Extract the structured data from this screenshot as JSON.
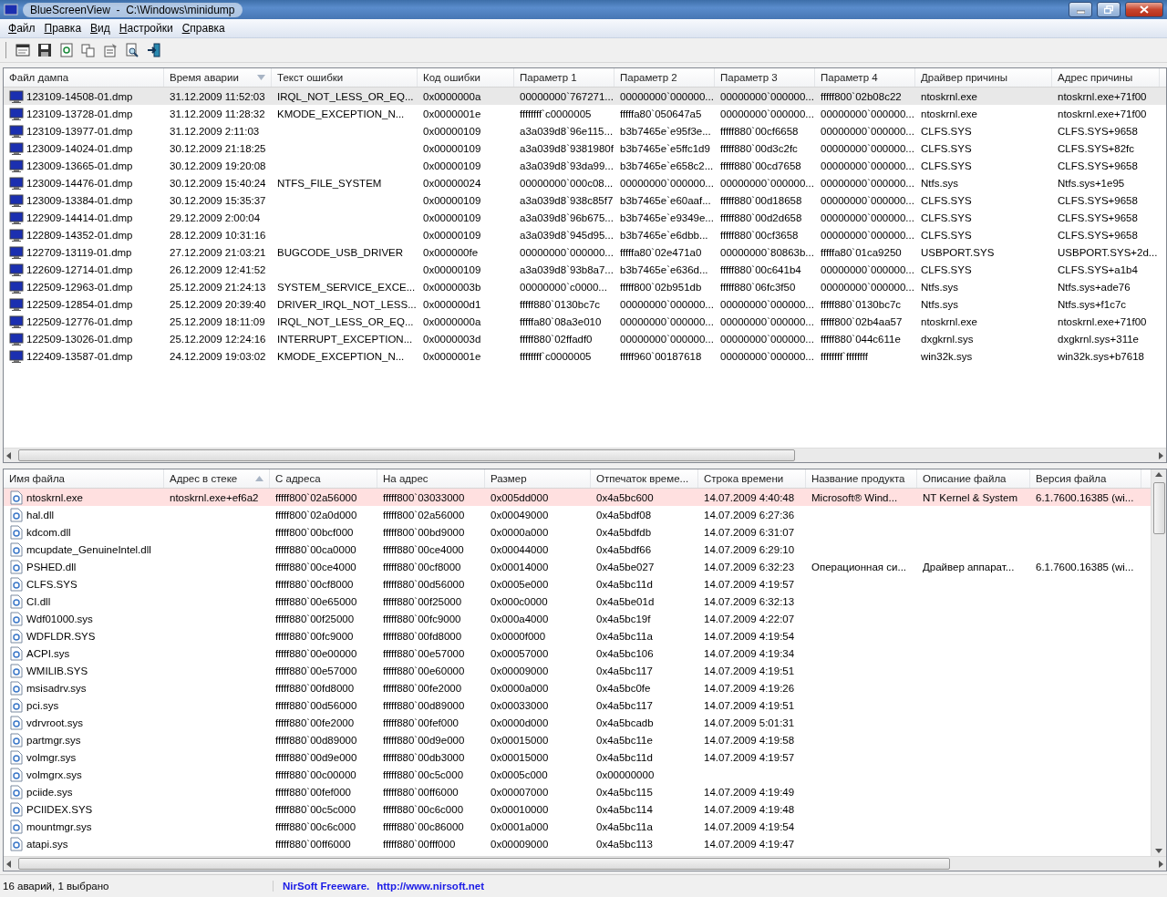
{
  "window": {
    "title": "BlueScreenView  -  C:\\Windows\\minidump"
  },
  "menu": [
    {
      "label": "Файл"
    },
    {
      "label": "Правка"
    },
    {
      "label": "Вид"
    },
    {
      "label": "Настройки"
    },
    {
      "label": "Справка"
    }
  ],
  "crashes": {
    "columns": [
      {
        "label": "Файл дампа",
        "sorted": false
      },
      {
        "label": "Время аварии",
        "sorted": true,
        "descending": true
      },
      {
        "label": "Текст ошибки",
        "sorted": false
      },
      {
        "label": "Код ошибки",
        "sorted": false
      },
      {
        "label": "Параметр 1",
        "sorted": false
      },
      {
        "label": "Параметр 2",
        "sorted": false
      },
      {
        "label": "Параметр 3",
        "sorted": false
      },
      {
        "label": "Параметр 4",
        "sorted": false
      },
      {
        "label": "Драйвер причины",
        "sorted": false
      },
      {
        "label": "Адрес причины",
        "sorted": false
      }
    ],
    "rows": [
      {
        "selected": true,
        "cells": [
          "123109-14508-01.dmp",
          "31.12.2009 11:52:03",
          "IRQL_NOT_LESS_OR_EQ...",
          "0x0000000a",
          "00000000`767271...",
          "00000000`000000...",
          "00000000`000000...",
          "fffff800`02b08c22",
          "ntoskrnl.exe",
          "ntoskrnl.exe+71f00"
        ]
      },
      {
        "selected": false,
        "cells": [
          "123109-13728-01.dmp",
          "31.12.2009 11:28:32",
          "KMODE_EXCEPTION_N...",
          "0x0000001e",
          "ffffffff`c0000005",
          "fffffa80`050647a5",
          "00000000`000000...",
          "00000000`000000...",
          "ntoskrnl.exe",
          "ntoskrnl.exe+71f00"
        ]
      },
      {
        "selected": false,
        "cells": [
          "123109-13977-01.dmp",
          "31.12.2009 2:11:03",
          null,
          "0x00000109",
          "a3a039d8`96e115...",
          "b3b7465e`e95f3e...",
          "fffff880`00cf6658",
          "00000000`000000...",
          "CLFS.SYS",
          "CLFS.SYS+9658"
        ]
      },
      {
        "selected": false,
        "cells": [
          "123009-14024-01.dmp",
          "30.12.2009 21:18:25",
          null,
          "0x00000109",
          "a3a039d8`9381980f",
          "b3b7465e`e5ffc1d9",
          "fffff880`00d3c2fc",
          "00000000`000000...",
          "CLFS.SYS",
          "CLFS.SYS+82fc"
        ]
      },
      {
        "selected": false,
        "cells": [
          "123009-13665-01.dmp",
          "30.12.2009 19:20:08",
          null,
          "0x00000109",
          "a3a039d8`93da99...",
          "b3b7465e`e658c2...",
          "fffff880`00cd7658",
          "00000000`000000...",
          "CLFS.SYS",
          "CLFS.SYS+9658"
        ]
      },
      {
        "selected": false,
        "cells": [
          "123009-14476-01.dmp",
          "30.12.2009 15:40:24",
          "NTFS_FILE_SYSTEM",
          "0x00000024",
          "00000000`000c08...",
          "00000000`000000...",
          "00000000`000000...",
          "00000000`000000...",
          "Ntfs.sys",
          "Ntfs.sys+1e95"
        ]
      },
      {
        "selected": false,
        "cells": [
          "123009-13384-01.dmp",
          "30.12.2009 15:35:37",
          null,
          "0x00000109",
          "a3a039d8`938c85f7",
          "b3b7465e`e60aaf...",
          "fffff880`00d18658",
          "00000000`000000...",
          "CLFS.SYS",
          "CLFS.SYS+9658"
        ]
      },
      {
        "selected": false,
        "cells": [
          "122909-14414-01.dmp",
          "29.12.2009 2:00:04",
          null,
          "0x00000109",
          "a3a039d8`96b675...",
          "b3b7465e`e9349e...",
          "fffff880`00d2d658",
          "00000000`000000...",
          "CLFS.SYS",
          "CLFS.SYS+9658"
        ]
      },
      {
        "selected": false,
        "cells": [
          "122809-14352-01.dmp",
          "28.12.2009 10:31:16",
          null,
          "0x00000109",
          "a3a039d8`945d95...",
          "b3b7465e`e6dbb...",
          "fffff880`00cf3658",
          "00000000`000000...",
          "CLFS.SYS",
          "CLFS.SYS+9658"
        ]
      },
      {
        "selected": false,
        "cells": [
          "122709-13119-01.dmp",
          "27.12.2009 21:03:21",
          "BUGCODE_USB_DRIVER",
          "0x000000fe",
          "00000000`000000...",
          "fffffa80`02e471a0",
          "00000000`80863b...",
          "fffffa80`01ca9250",
          "USBPORT.SYS",
          "USBPORT.SYS+2d..."
        ]
      },
      {
        "selected": false,
        "cells": [
          "122609-12714-01.dmp",
          "26.12.2009 12:41:52",
          null,
          "0x00000109",
          "a3a039d8`93b8a7...",
          "b3b7465e`e636d...",
          "fffff880`00c641b4",
          "00000000`000000...",
          "CLFS.SYS",
          "CLFS.SYS+a1b4"
        ]
      },
      {
        "selected": false,
        "cells": [
          "122509-12963-01.dmp",
          "25.12.2009 21:24:13",
          "SYSTEM_SERVICE_EXCE...",
          "0x0000003b",
          "00000000`c0000...",
          "fffff800`02b951db",
          "fffff880`06fc3f50",
          "00000000`000000...",
          "Ntfs.sys",
          "Ntfs.sys+ade76"
        ]
      },
      {
        "selected": false,
        "cells": [
          "122509-12854-01.dmp",
          "25.12.2009 20:39:40",
          "DRIVER_IRQL_NOT_LESS...",
          "0x000000d1",
          "fffff880`0130bc7c",
          "00000000`000000...",
          "00000000`000000...",
          "fffff880`0130bc7c",
          "Ntfs.sys",
          "Ntfs.sys+f1c7c"
        ]
      },
      {
        "selected": false,
        "cells": [
          "122509-12776-01.dmp",
          "25.12.2009 18:11:09",
          "IRQL_NOT_LESS_OR_EQ...",
          "0x0000000a",
          "fffffa80`08a3e010",
          "00000000`000000...",
          "00000000`000000...",
          "fffff800`02b4aa57",
          "ntoskrnl.exe",
          "ntoskrnl.exe+71f00"
        ]
      },
      {
        "selected": false,
        "cells": [
          "122509-13026-01.dmp",
          "25.12.2009 12:24:16",
          "INTERRUPT_EXCEPTION...",
          "0x0000003d",
          "fffff880`02ffadf0",
          "00000000`000000...",
          "00000000`000000...",
          "fffff880`044c611e",
          "dxgkrnl.sys",
          "dxgkrnl.sys+311e"
        ]
      },
      {
        "selected": false,
        "cells": [
          "122409-13587-01.dmp",
          "24.12.2009 19:03:02",
          "KMODE_EXCEPTION_N...",
          "0x0000001e",
          "ffffffff`c0000005",
          "fffff960`00187618",
          "00000000`000000...",
          "ffffffff`ffffffff",
          "win32k.sys",
          "win32k.sys+b7618"
        ]
      }
    ]
  },
  "modules": {
    "columns": [
      {
        "label": "Имя файла",
        "sorted": false
      },
      {
        "label": "Адрес в стеке",
        "sorted": true,
        "descending": false
      },
      {
        "label": "С адреса",
        "sorted": false
      },
      {
        "label": "На адрес",
        "sorted": false
      },
      {
        "label": "Размер",
        "sorted": false
      },
      {
        "label": "Отпечаток време...",
        "sorted": false
      },
      {
        "label": "Строка времени",
        "sorted": false
      },
      {
        "label": "Название продукта",
        "sorted": false
      },
      {
        "label": "Описание файла",
        "sorted": false
      },
      {
        "label": "Версия файла",
        "sorted": false
      }
    ],
    "rows": [
      {
        "highlighted": true,
        "cells": [
          "ntoskrnl.exe",
          "ntoskrnl.exe+ef6a2",
          "fffff800`02a56000",
          "fffff800`03033000",
          "0x005dd000",
          "0x4a5bc600",
          "14.07.2009 4:40:48",
          "Microsoft® Wind...",
          "NT Kernel & System",
          "6.1.7600.16385 (wi..."
        ]
      },
      {
        "highlighted": false,
        "cells": [
          "hal.dll",
          null,
          "fffff800`02a0d000",
          "fffff800`02a56000",
          "0x00049000",
          "0x4a5bdf08",
          "14.07.2009 6:27:36"
        ]
      },
      {
        "highlighted": false,
        "cells": [
          "kdcom.dll",
          null,
          "fffff800`00bcf000",
          "fffff800`00bd9000",
          "0x0000a000",
          "0x4a5bdfdb",
          "14.07.2009 6:31:07"
        ]
      },
      {
        "highlighted": false,
        "cells": [
          "mcupdate_GenuineIntel.dll",
          null,
          "fffff880`00ca0000",
          "fffff880`00ce4000",
          "0x00044000",
          "0x4a5bdf66",
          "14.07.2009 6:29:10"
        ]
      },
      {
        "highlighted": false,
        "cells": [
          "PSHED.dll",
          null,
          "fffff880`00ce4000",
          "fffff880`00cf8000",
          "0x00014000",
          "0x4a5be027",
          "14.07.2009 6:32:23",
          "Операционная си...",
          "Драйвер аппарат...",
          "6.1.7600.16385 (wi..."
        ]
      },
      {
        "highlighted": false,
        "cells": [
          "CLFS.SYS",
          null,
          "fffff880`00cf8000",
          "fffff880`00d56000",
          "0x0005e000",
          "0x4a5bc11d",
          "14.07.2009 4:19:57"
        ]
      },
      {
        "highlighted": false,
        "cells": [
          "CI.dll",
          null,
          "fffff880`00e65000",
          "fffff880`00f25000",
          "0x000c0000",
          "0x4a5be01d",
          "14.07.2009 6:32:13"
        ]
      },
      {
        "highlighted": false,
        "cells": [
          "Wdf01000.sys",
          null,
          "fffff880`00f25000",
          "fffff880`00fc9000",
          "0x000a4000",
          "0x4a5bc19f",
          "14.07.2009 4:22:07"
        ]
      },
      {
        "highlighted": false,
        "cells": [
          "WDFLDR.SYS",
          null,
          "fffff880`00fc9000",
          "fffff880`00fd8000",
          "0x0000f000",
          "0x4a5bc11a",
          "14.07.2009 4:19:54"
        ]
      },
      {
        "highlighted": false,
        "cells": [
          "ACPI.sys",
          null,
          "fffff880`00e00000",
          "fffff880`00e57000",
          "0x00057000",
          "0x4a5bc106",
          "14.07.2009 4:19:34"
        ]
      },
      {
        "highlighted": false,
        "cells": [
          "WMILIB.SYS",
          null,
          "fffff880`00e57000",
          "fffff880`00e60000",
          "0x00009000",
          "0x4a5bc117",
          "14.07.2009 4:19:51"
        ]
      },
      {
        "highlighted": false,
        "cells": [
          "msisadrv.sys",
          null,
          "fffff880`00fd8000",
          "fffff880`00fe2000",
          "0x0000a000",
          "0x4a5bc0fe",
          "14.07.2009 4:19:26"
        ]
      },
      {
        "highlighted": false,
        "cells": [
          "pci.sys",
          null,
          "fffff880`00d56000",
          "fffff880`00d89000",
          "0x00033000",
          "0x4a5bc117",
          "14.07.2009 4:19:51"
        ]
      },
      {
        "highlighted": false,
        "cells": [
          "vdrvroot.sys",
          null,
          "fffff880`00fe2000",
          "fffff880`00fef000",
          "0x0000d000",
          "0x4a5bcadb",
          "14.07.2009 5:01:31"
        ]
      },
      {
        "highlighted": false,
        "cells": [
          "partmgr.sys",
          null,
          "fffff880`00d89000",
          "fffff880`00d9e000",
          "0x00015000",
          "0x4a5bc11e",
          "14.07.2009 4:19:58"
        ]
      },
      {
        "highlighted": false,
        "cells": [
          "volmgr.sys",
          null,
          "fffff880`00d9e000",
          "fffff880`00db3000",
          "0x00015000",
          "0x4a5bc11d",
          "14.07.2009 4:19:57"
        ]
      },
      {
        "highlighted": false,
        "cells": [
          "volmgrx.sys",
          null,
          "fffff880`00c00000",
          "fffff880`00c5c000",
          "0x0005c000",
          "0x00000000"
        ]
      },
      {
        "highlighted": false,
        "cells": [
          "pciide.sys",
          null,
          "fffff880`00fef000",
          "fffff880`00ff6000",
          "0x00007000",
          "0x4a5bc115",
          "14.07.2009 4:19:49"
        ]
      },
      {
        "highlighted": false,
        "cells": [
          "PCIIDEX.SYS",
          null,
          "fffff880`00c5c000",
          "fffff880`00c6c000",
          "0x00010000",
          "0x4a5bc114",
          "14.07.2009 4:19:48"
        ]
      },
      {
        "highlighted": false,
        "cells": [
          "mountmgr.sys",
          null,
          "fffff880`00c6c000",
          "fffff880`00c86000",
          "0x0001a000",
          "0x4a5bc11a",
          "14.07.2009 4:19:54"
        ]
      },
      {
        "highlighted": false,
        "cells": [
          "atapi.sys",
          null,
          "fffff880`00ff6000",
          "fffff880`00fff000",
          "0x00009000",
          "0x4a5bc113",
          "14.07.2009 4:19:47"
        ]
      }
    ]
  },
  "status_bar": {
    "summary": "16 аварий, 1 выбрано",
    "credit": "NirSoft Freeware.",
    "link": "http://www.nirsoft.net"
  }
}
